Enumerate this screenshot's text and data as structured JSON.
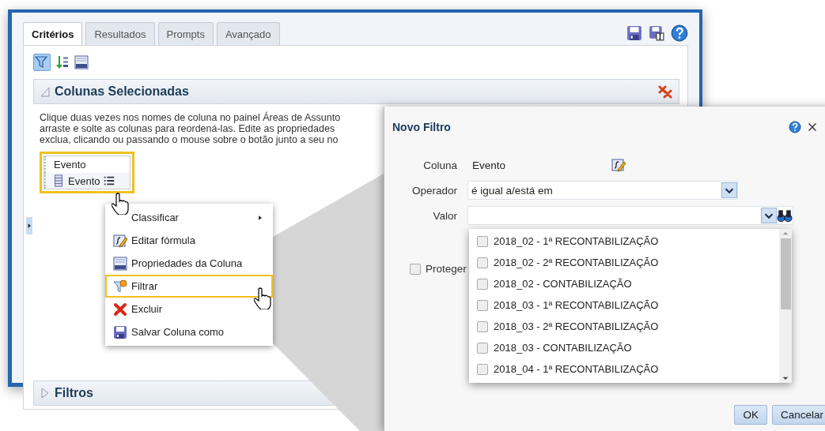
{
  "main_window": {
    "tabs": [
      {
        "label": "Critérios",
        "selected": true
      },
      {
        "label": "Resultados",
        "selected": false
      },
      {
        "label": "Prompts",
        "selected": false
      },
      {
        "label": "Avançado",
        "selected": false
      }
    ],
    "toolbar_buttons": [
      {
        "selected": true
      },
      {
        "selected": false
      },
      {
        "selected": false
      }
    ],
    "panels": [
      {
        "title": "Colunas Selecionadas",
        "expanded": true,
        "description_lines": [
          "Clique duas vezes nos nomes de coluna no painel Áreas de Assunto",
          "arraste e solte as colunas para reordená-las. Edite as propriedades",
          "exclua, clicando ou passando o mouse sobre o botão junto a seu no"
        ],
        "column": {
          "heading": "Evento",
          "name": "Evento"
        }
      },
      {
        "title": "Filtros",
        "expanded": false
      }
    ]
  },
  "context_menu": {
    "items": [
      {
        "label": "Classificar",
        "submenu": true,
        "selected": false
      },
      {
        "label": "Editar fórmula",
        "submenu": false,
        "selected": false
      },
      {
        "label": "Propriedades da Coluna",
        "submenu": false,
        "selected": false
      },
      {
        "label": "Filtrar",
        "submenu": false,
        "selected": true
      },
      {
        "label": "Excluir",
        "submenu": false,
        "selected": false
      },
      {
        "label": "Salvar Coluna como",
        "submenu": false,
        "selected": false
      }
    ]
  },
  "dialog": {
    "title": "Novo Filtro",
    "fields": [
      {
        "label": "Coluna",
        "kind": "text",
        "value": "Evento"
      },
      {
        "label": "Operador",
        "kind": "select",
        "value": "é igual a/está em"
      },
      {
        "label": "Valor",
        "kind": "combo"
      }
    ],
    "options": [
      {
        "label": "2018_02 - 1ª RECONTABILIZAÇÃO",
        "checked": false
      },
      {
        "label": "2018_02 - 2ª RECONTABILIZAÇÃO",
        "checked": false
      },
      {
        "label": "2018_02 - CONTABILIZAÇÃO",
        "checked": false
      },
      {
        "label": "2018_03 - 1ª RECONTABILIZAÇÃO",
        "checked": false
      },
      {
        "label": "2018_03 - 2ª RECONTABILIZAÇÃO",
        "checked": false
      },
      {
        "label": "2018_03 - CONTABILIZAÇÃO",
        "checked": false
      },
      {
        "label": "2018_04 - 1ª RECONTABILIZAÇÃO",
        "checked": false
      }
    ],
    "protect": {
      "label": "Proteger",
      "checked": false
    },
    "buttons": [
      "OK",
      "Cancelar"
    ]
  }
}
